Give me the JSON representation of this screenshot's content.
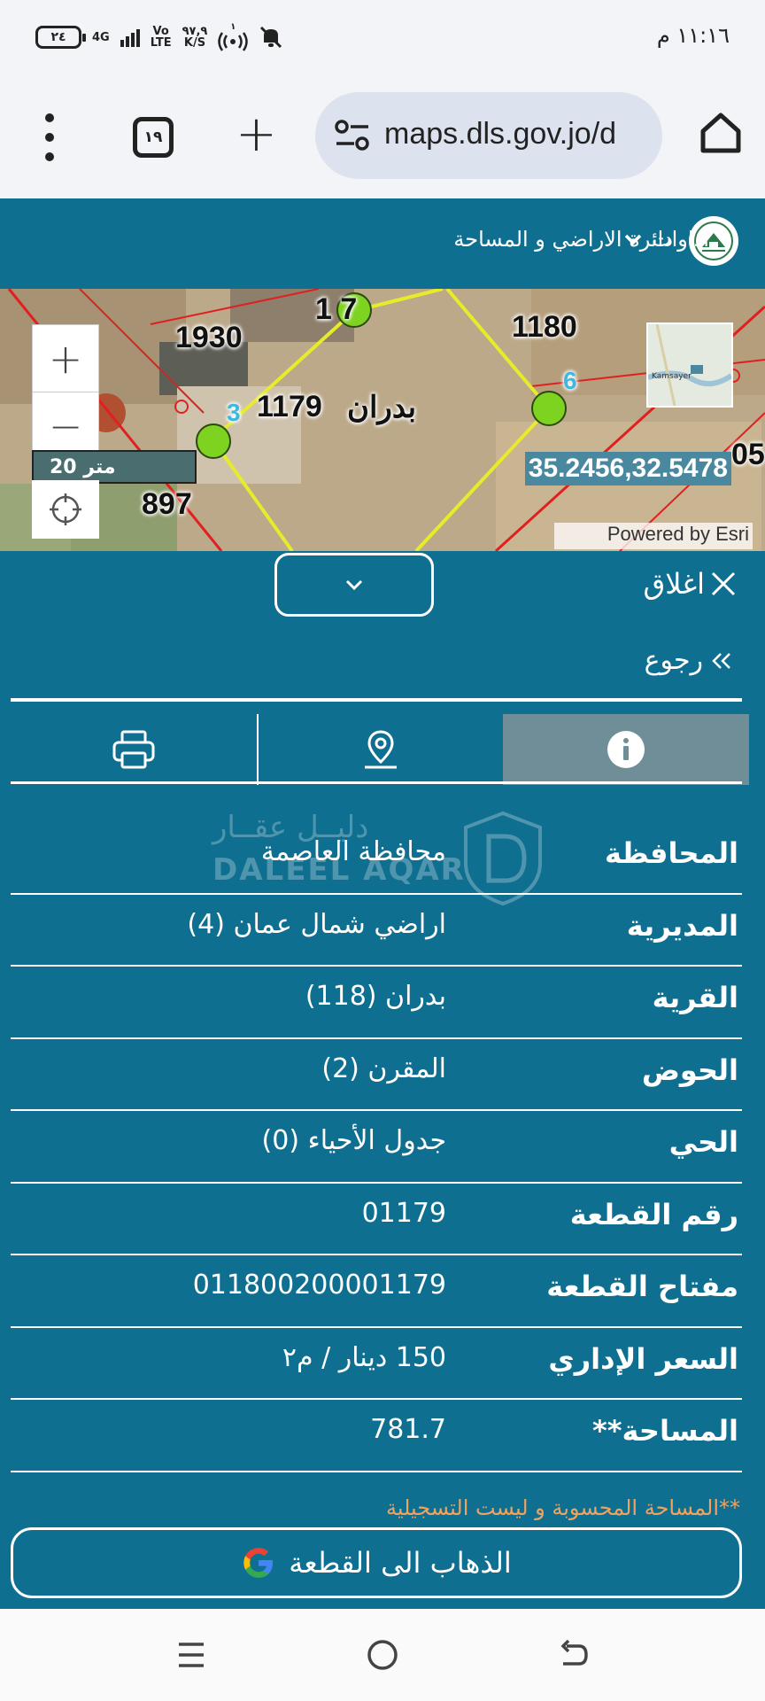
{
  "status_bar": {
    "time": "١١:١٦ م",
    "battery": "٢٤",
    "network": "4G",
    "volte_top": "Vo",
    "volte_bottom": "LTE",
    "speed_value": "٩٧,٩",
    "speed_unit": "K/S",
    "hotspot_count": "١"
  },
  "browser": {
    "url": "maps.dls.gov.jo/d",
    "tab_count": "١٩"
  },
  "app_header": {
    "org_name": "دائرة الاراضي و المساحة",
    "tools_label": "اداوات"
  },
  "map": {
    "scale_label": "20 متر",
    "coordinates": "35.2456,32.5478",
    "attribution": "Powered by Esri",
    "parcel_labels": [
      "1930",
      "1180",
      "1179",
      "897",
      "1 7",
      "05"
    ],
    "village_label": "بدران",
    "vertex_numbers": [
      "3",
      "6"
    ],
    "minimap_label": "Kamsayer",
    "zoom_in": "+",
    "zoom_out": "−"
  },
  "collapse": {
    "close_label": "اغلاق"
  },
  "panel": {
    "back_label": "رجوع",
    "watermark_ar": "دليــل عقــار",
    "watermark_en": "DALEEL AQAR",
    "rows": [
      {
        "label": "المحافظة",
        "value": "محافظة العاصمة"
      },
      {
        "label": "المديرية",
        "value": "اراضي شمال عمان (4)"
      },
      {
        "label": "القرية",
        "value": "بدران (118)"
      },
      {
        "label": "الحوض",
        "value": "المقرن (2)"
      },
      {
        "label": "الحي",
        "value": "جدول الأحياء (0)"
      },
      {
        "label": "رقم القطعة",
        "value": "01179"
      },
      {
        "label": "مفتاح القطعة",
        "value": "011800200001179"
      },
      {
        "label": "السعر الإداري",
        "value": "150 دينار / م٢"
      },
      {
        "label": "المساحة**",
        "value": "781.7"
      }
    ],
    "note": "**المساحة المحسوبة و ليست التسجيلية",
    "goto_label": "الذهاب الى القطعة"
  },
  "colors": {
    "primary": "#0f6f90",
    "active_tab": "#6f8e97",
    "note": "#f0a35e",
    "parcel_outline": "#e6ec2a",
    "boundary": "#e02020"
  }
}
